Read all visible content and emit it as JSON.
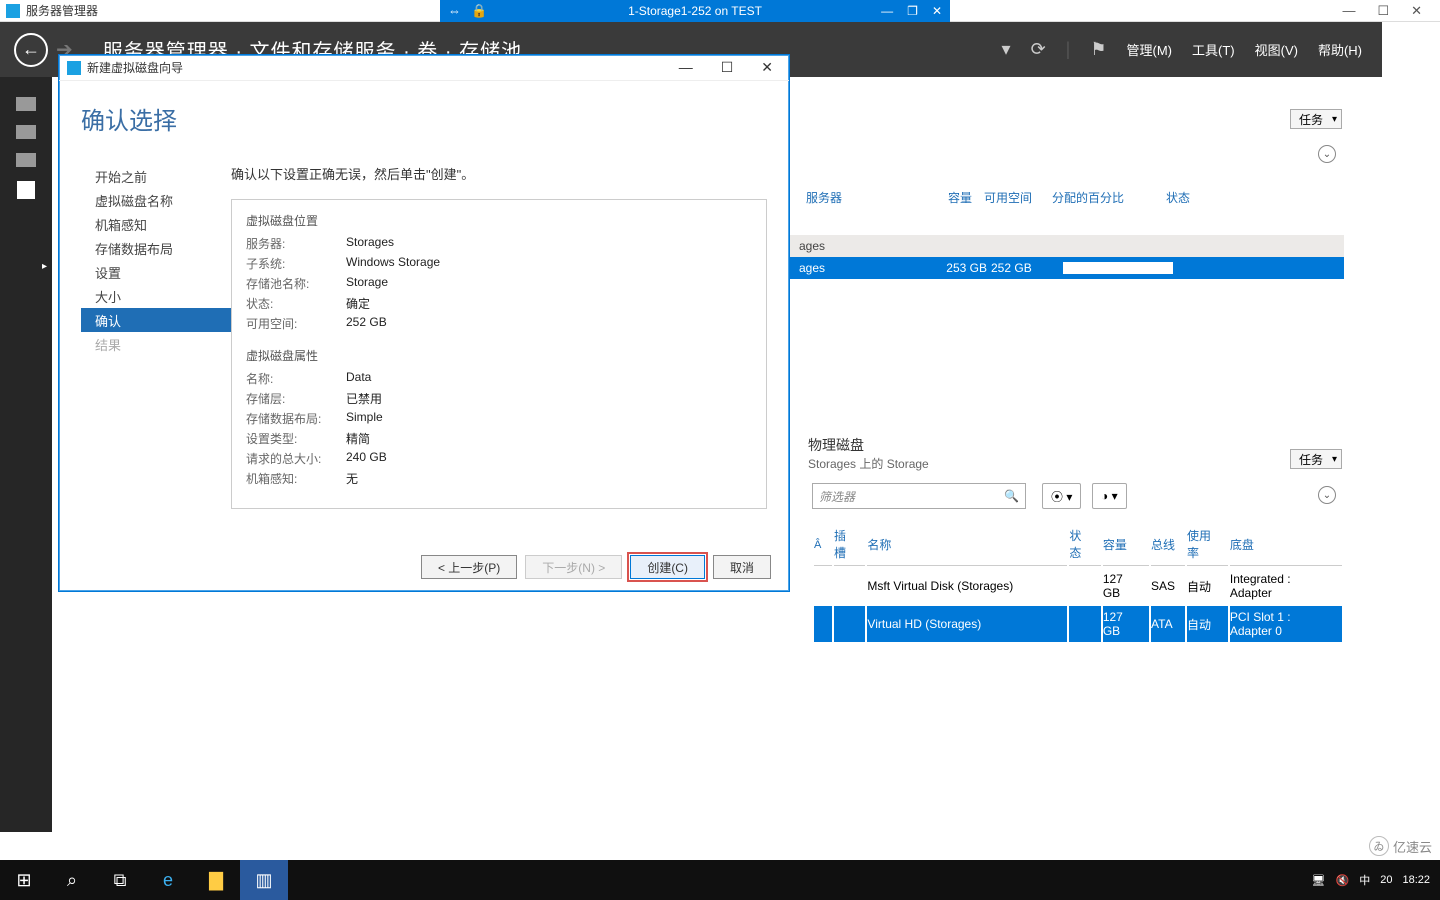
{
  "host": {
    "app_title": "服务器管理器",
    "vm_title": "1-Storage1-252 on TEST",
    "win_min": "—",
    "win_max": "☐",
    "win_close": "✕"
  },
  "header": {
    "breadcrumb": "服务器管理器 · 文件和存储服务 · 卷 · 存储池",
    "menus": [
      "管理(M)",
      "工具(T)",
      "视图(V)",
      "帮助(H)"
    ]
  },
  "tasks_label": "任务",
  "pool_cols": {
    "server": "服务器",
    "capacity": "容量",
    "free": "可用空间",
    "alloc": "分配的百分比",
    "status": "状态"
  },
  "pool_group": "ages",
  "pool_row": {
    "name": "ages",
    "capacity": "253 GB",
    "free": "252 GB"
  },
  "phys": {
    "title": "物理磁盘",
    "subtitle": "Storages 上的 Storage",
    "filter_placeholder": "筛选器",
    "cols": {
      "slot": "插槽",
      "name": "名称",
      "status": "状态",
      "capacity": "容量",
      "bus": "总线",
      "usage": "使用率",
      "chassis": "底盘"
    },
    "rows": [
      {
        "name": "Msft Virtual Disk (Storages)",
        "capacity": "127 GB",
        "bus": "SAS",
        "usage": "自动",
        "chassis": "Integrated : Adapter"
      },
      {
        "name": "Virtual HD (Storages)",
        "capacity": "127 GB",
        "bus": "ATA",
        "usage": "自动",
        "chassis": "PCI Slot 1 : Adapter 0"
      }
    ]
  },
  "wizard": {
    "window_title": "新建虚拟磁盘向导",
    "page_title": "确认选择",
    "intro": "确认以下设置正确无误，然后单击\"创建\"。",
    "steps": [
      "开始之前",
      "虚拟磁盘名称",
      "机箱感知",
      "存储数据布局",
      "设置",
      "大小",
      "确认",
      "结果"
    ],
    "sec1": "虚拟磁盘位置",
    "loc": {
      "server_k": "服务器:",
      "server_v": "Storages",
      "subsys_k": "子系统:",
      "subsys_v": "Windows Storage",
      "pool_k": "存储池名称:",
      "pool_v": "Storage",
      "status_k": "状态:",
      "status_v": "确定",
      "free_k": "可用空间:",
      "free_v": "252 GB"
    },
    "sec2": "虚拟磁盘属性",
    "prop": {
      "name_k": "名称:",
      "name_v": "Data",
      "tier_k": "存储层:",
      "tier_v": "已禁用",
      "layout_k": "存储数据布局:",
      "layout_v": "Simple",
      "prov_k": "设置类型:",
      "prov_v": "精简",
      "size_k": "请求的总大小:",
      "size_v": "240 GB",
      "aware_k": "机箱感知:",
      "aware_v": "无"
    },
    "btn_prev": "< 上一步(P)",
    "btn_next": "下一步(N) >",
    "btn_create": "创建(C)",
    "btn_cancel": "取消"
  },
  "taskbar": {
    "time": "18:22",
    "ime": "中",
    "num": "20"
  },
  "watermark": "亿速云"
}
